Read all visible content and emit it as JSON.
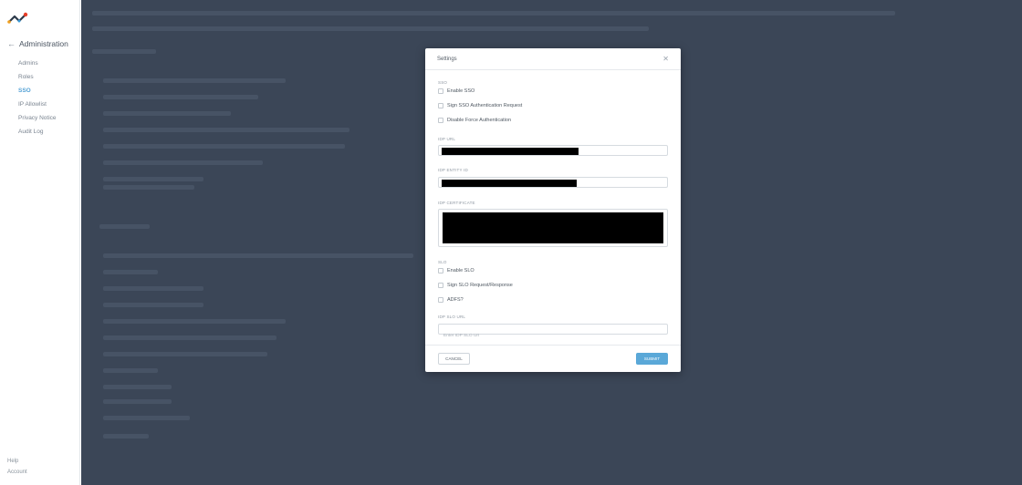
{
  "sidebar": {
    "title": "Administration",
    "items": [
      {
        "label": "Admins"
      },
      {
        "label": "Roles"
      },
      {
        "label": "SSO"
      },
      {
        "label": "IP Allowlist"
      },
      {
        "label": "Privacy Notice"
      },
      {
        "label": "Audit Log"
      }
    ],
    "active_item": "SSO",
    "footer": {
      "help": "Help",
      "account": "Account"
    }
  },
  "modal": {
    "title": "Settings",
    "sso_section": "SSO",
    "sso_options": [
      {
        "label": "Enable SSO",
        "checked": false
      },
      {
        "label": "Sign SSO Authentication Request",
        "checked": false
      },
      {
        "label": "Disable Force Authentication",
        "checked": false
      }
    ],
    "idp_url_label": "IDP URL",
    "idp_entity_label": "IDP ENTITY ID",
    "idp_certificate_label": "IDP CERTIFICATE",
    "slo_section": "SLO",
    "slo_options": [
      {
        "label": "Enable SLO",
        "checked": false
      },
      {
        "label": "Sign SLO Request/Response",
        "checked": false
      },
      {
        "label": "ADFS?",
        "checked": false
      }
    ],
    "idp_slo_url_label": "IDP SLO URL",
    "idp_slo_url_placeholder": "Enter IDP SLO Url",
    "cancel_label": "CANCEL",
    "submit_label": "SUBMIT"
  },
  "colors": {
    "accent": "#55a2d6",
    "submit_button": "#5aa8d8",
    "backdrop": "#3b4657"
  }
}
